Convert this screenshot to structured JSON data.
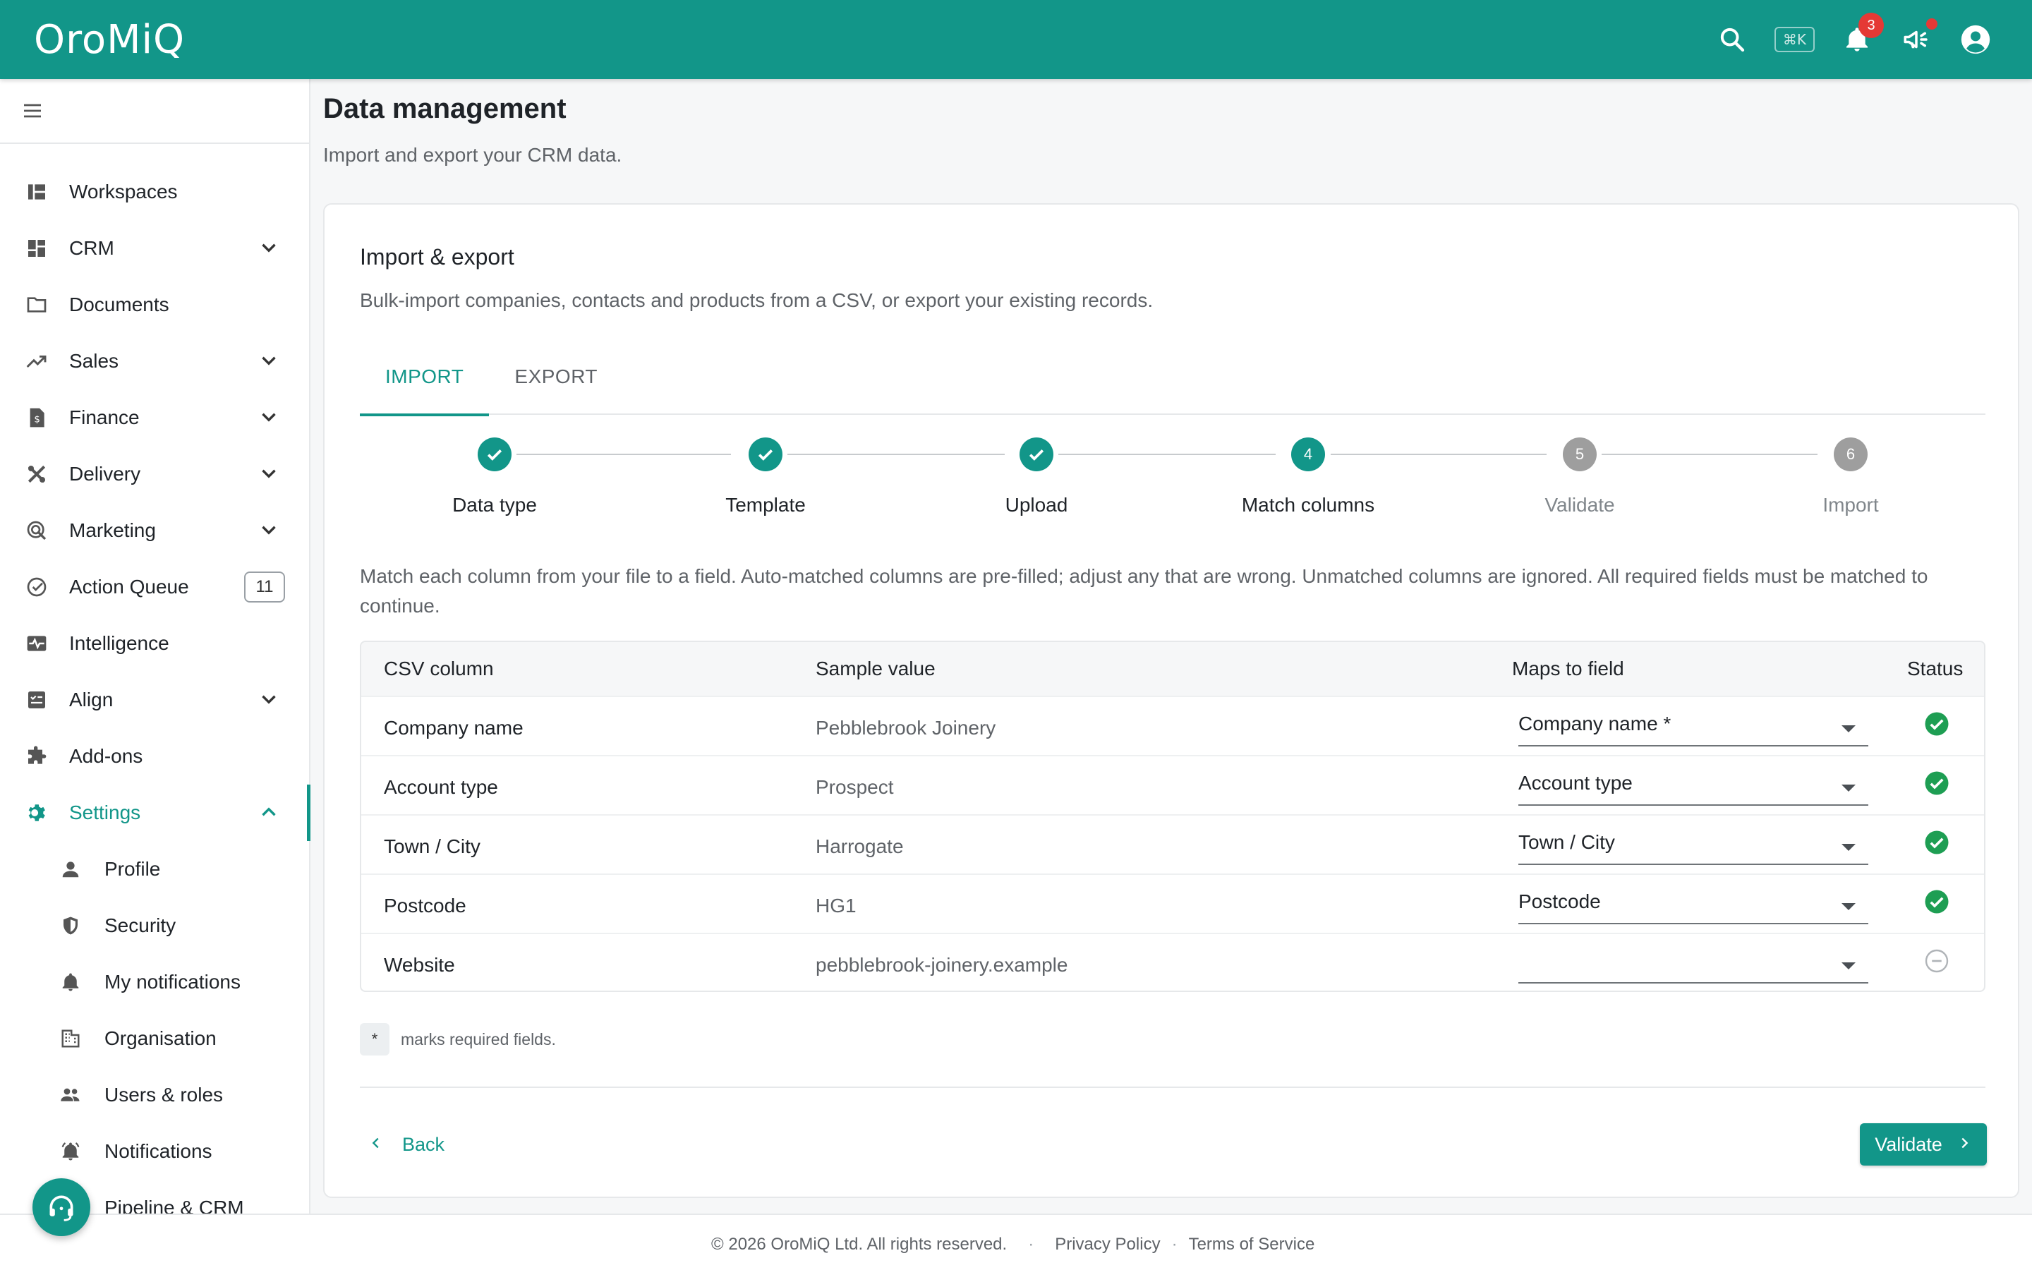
{
  "app": {
    "logo": "OroMiQ"
  },
  "topbar": {
    "kbd_hint": "⌘K",
    "notification_count": "3"
  },
  "sidebar": {
    "items": [
      {
        "label": "Workspaces",
        "icon": "dashboard-icon"
      },
      {
        "label": "CRM",
        "icon": "grid-icon"
      },
      {
        "label": "Documents",
        "icon": "folder-icon"
      },
      {
        "label": "Sales",
        "icon": "trending-up-icon"
      },
      {
        "label": "Finance",
        "icon": "invoice-icon"
      },
      {
        "label": "Delivery",
        "icon": "tools-icon"
      },
      {
        "label": "Marketing",
        "icon": "target-click-icon"
      },
      {
        "label": "Action Queue",
        "icon": "check-circle-icon",
        "count": "11"
      },
      {
        "label": "Intelligence",
        "icon": "pulse-icon"
      },
      {
        "label": "Align",
        "icon": "checklist-icon"
      },
      {
        "label": "Add-ons",
        "icon": "puzzle-icon"
      },
      {
        "label": "Settings",
        "icon": "gear-icon"
      }
    ],
    "settings_sub": [
      {
        "label": "Profile"
      },
      {
        "label": "Security"
      },
      {
        "label": "My notifications"
      },
      {
        "label": "Organisation"
      },
      {
        "label": "Users & roles"
      },
      {
        "label": "Notifications"
      },
      {
        "label": "Pipeline & CRM"
      }
    ]
  },
  "page": {
    "title": "Data management",
    "subtitle": "Import and export your CRM data."
  },
  "card": {
    "title": "Import & export",
    "subtitle": "Bulk-import companies, contacts and products from a CSV, or export your existing records.",
    "tabs": [
      "IMPORT",
      "EXPORT"
    ],
    "steps": [
      {
        "number": "1",
        "label": "Data type",
        "state": "done"
      },
      {
        "number": "2",
        "label": "Template",
        "state": "done"
      },
      {
        "number": "3",
        "label": "Upload",
        "state": "done"
      },
      {
        "number": "4",
        "label": "Match columns",
        "state": "active"
      },
      {
        "number": "5",
        "label": "Validate",
        "state": "pending"
      },
      {
        "number": "6",
        "label": "Import",
        "state": "pending"
      }
    ],
    "instructions": "Match each column from your file to a field. Auto-matched columns are pre-filled; adjust any that are wrong. Unmatched columns are ignored. All required fields must be matched to continue.",
    "table": {
      "headers": [
        "CSV column",
        "Sample value",
        "Maps to field",
        "Status"
      ],
      "rows": [
        {
          "column": "Company name",
          "sample": "Pebblebrook Joinery",
          "field": "Company name *",
          "status": "matched"
        },
        {
          "column": "Account type",
          "sample": "Prospect",
          "field": "Account type",
          "status": "matched"
        },
        {
          "column": "Town / City",
          "sample": "Harrogate",
          "field": "Town / City",
          "status": "matched"
        },
        {
          "column": "Postcode",
          "sample": "HG1",
          "field": "Postcode",
          "status": "matched"
        },
        {
          "column": "Website",
          "sample": "pebblebrook-joinery.example",
          "field": "",
          "status": "ignored"
        }
      ]
    },
    "note_chip": "*",
    "note_text": "marks required fields.",
    "back_label": "Back",
    "validate_label": "Validate"
  },
  "footer": {
    "copyright": "© 2026 OroMiQ Ltd. All rights reserved.",
    "separator": "·",
    "privacy": "Privacy Policy",
    "terms": "Terms of Service"
  },
  "colors": {
    "brand": "#129689",
    "success": "#1e9e53",
    "badge": "#e53935"
  }
}
